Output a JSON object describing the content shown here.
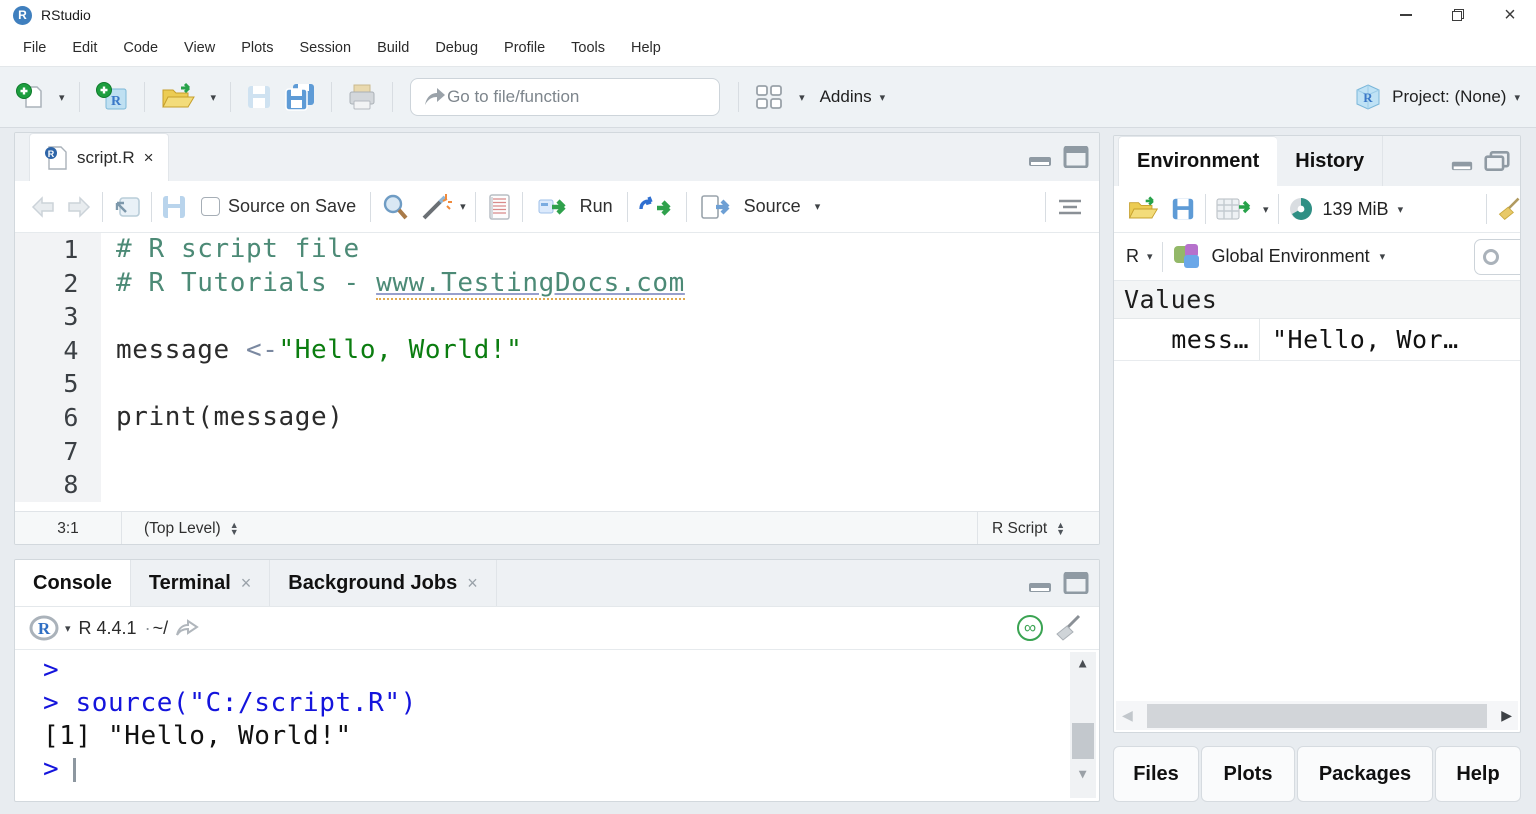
{
  "window": {
    "title": "RStudio"
  },
  "menu": {
    "items": [
      "File",
      "Edit",
      "Code",
      "View",
      "Plots",
      "Session",
      "Build",
      "Debug",
      "Profile",
      "Tools",
      "Help"
    ]
  },
  "toolbar": {
    "goto_placeholder": "Go to file/function",
    "addins_label": "Addins",
    "project_label": "Project: (None)"
  },
  "editor": {
    "tab_label": "script.R",
    "source_on_save_label": "Source on Save",
    "run_label": "Run",
    "source_label": "Source",
    "line_numbers": [
      "1",
      "2",
      "3",
      "4",
      "5",
      "6",
      "7",
      "8"
    ],
    "code": {
      "line1_comment": "# R script file",
      "line2_comment": "# R Tutorials - ",
      "line2_link": "www.TestingDocs.com",
      "line4_ident": "message ",
      "line4_op": "<-",
      "line4_string": "\"Hello, World!\"",
      "line6_code": "print(message)"
    },
    "status": {
      "cursor_position": "3:1",
      "scope": "(Top Level)",
      "file_type": "R Script"
    }
  },
  "console": {
    "tabs": [
      "Console",
      "Terminal",
      "Background Jobs"
    ],
    "r_version": "R 4.4.1",
    "separator": "·",
    "working_dir": "~/",
    "lines": [
      {
        "text": ">"
      },
      {
        "text": "> source(\"C:/script.R\")"
      },
      {
        "text": "[1] \"Hello, World!\""
      },
      {
        "text": ">"
      }
    ]
  },
  "environment": {
    "tabs": [
      "Environment",
      "History"
    ],
    "memory_label": "139 MiB",
    "language_label": "R",
    "scope_label": "Global Environment",
    "section_label": "Values",
    "variables": [
      {
        "name": "mess…",
        "value": "\"Hello, Wor…"
      }
    ]
  },
  "bottom_pane": {
    "tabs": [
      "Files",
      "Plots",
      "Packages",
      "Help"
    ]
  }
}
